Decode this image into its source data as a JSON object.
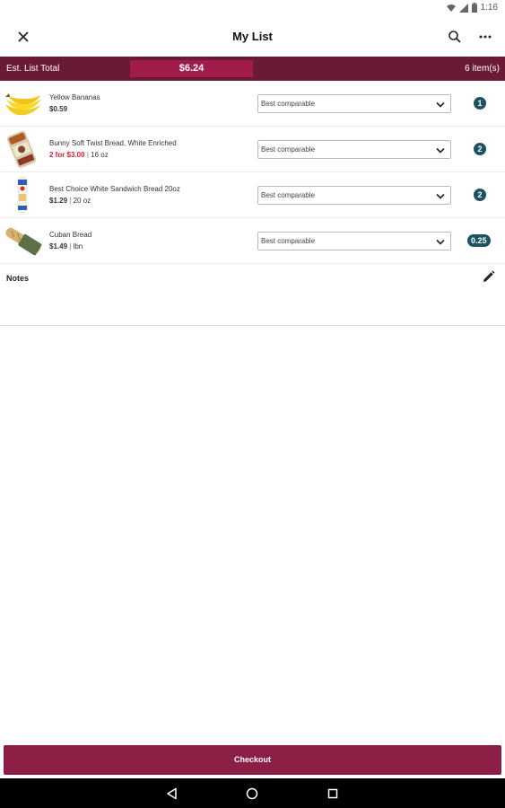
{
  "status": {
    "time": "1:16"
  },
  "app": {
    "title": "My List"
  },
  "summary": {
    "label": "Est. List Total",
    "total": "$6.24",
    "count": "6 item(s)"
  },
  "items": [
    {
      "name": "Yellow Bananas",
      "price": "$0.59",
      "promo": "",
      "size": "",
      "option": "Best comparable",
      "quantity": "1"
    },
    {
      "name": "Bunny Soft Twist Bread, White Enriched",
      "price": "",
      "promo": "2 for $3.00",
      "size": "16 oz",
      "option": "Best comparable",
      "quantity": "2"
    },
    {
      "name": "Best Choice White Sandwich Bread 20oz",
      "price": "$1.29",
      "promo": "",
      "size": "20 oz",
      "option": "Best comparable",
      "quantity": "2"
    },
    {
      "name": "Cuban Bread",
      "price": "$1.49",
      "promo": "",
      "size": "lbn",
      "option": "Best comparable",
      "quantity": "0.25"
    }
  ],
  "notes": {
    "label": "Notes"
  },
  "checkout": {
    "label": "Checkout"
  },
  "separator": "|",
  "icons": {
    "close": "close-icon",
    "search": "search-icon",
    "more": "more-vert-icon",
    "edit": "pencil-icon",
    "wifi": "wifi-icon",
    "signal": "signal-icon",
    "battery": "battery-icon",
    "back": "back-triangle-icon",
    "home": "home-circle-icon",
    "recents": "recents-square-icon"
  },
  "colors": {
    "header": "#6b1a36",
    "total_highlight": "#a01c4b",
    "checkout": "#8c1f45",
    "badge": "#1d5361",
    "promo": "#d1202f"
  }
}
